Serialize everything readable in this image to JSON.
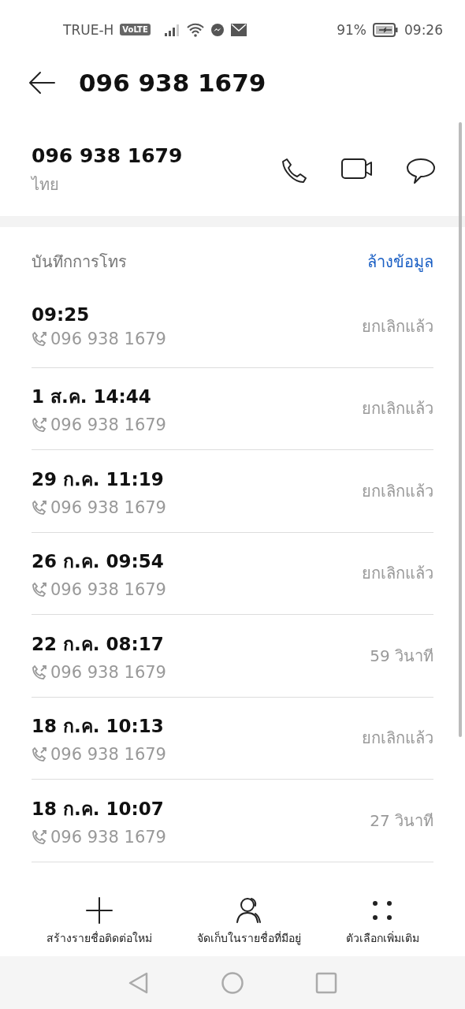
{
  "status_bar": {
    "carrier": "TRUE-H",
    "volte": "VoLTE",
    "battery": "91%",
    "time": "09:26"
  },
  "header": {
    "title": "096 938 1679"
  },
  "contact": {
    "number": "096 938 1679",
    "location": "ไทย"
  },
  "call_log": {
    "title": "บันทึกการโทร",
    "clear_link": "ล้างข้อมูล",
    "entries": [
      {
        "time": "09:25",
        "number": "096 938 1679",
        "result": "ยกเลิกแล้ว"
      },
      {
        "time": "1 ส.ค. 14:44",
        "number": "096 938 1679",
        "result": "ยกเลิกแล้ว"
      },
      {
        "time": "29 ก.ค. 11:19",
        "number": "096 938 1679",
        "result": "ยกเลิกแล้ว"
      },
      {
        "time": "26 ก.ค. 09:54",
        "number": "096 938 1679",
        "result": "ยกเลิกแล้ว"
      },
      {
        "time": "22 ก.ค. 08:17",
        "number": "096 938 1679",
        "result": "59 วินาที"
      },
      {
        "time": "18 ก.ค. 10:13",
        "number": "096 938 1679",
        "result": "ยกเลิกแล้ว"
      },
      {
        "time": "18 ก.ค. 10:07",
        "number": "096 938 1679",
        "result": "27 วินาที"
      }
    ]
  },
  "actions": [
    {
      "kind": "add",
      "label": "สร้างรายชื่อติดต่อใหม่"
    },
    {
      "kind": "contact",
      "label": "จัดเก็บในรายชื่อที่มีอยู่"
    },
    {
      "kind": "more",
      "label": "ตัวเลือกเพิ่มเติม"
    }
  ]
}
